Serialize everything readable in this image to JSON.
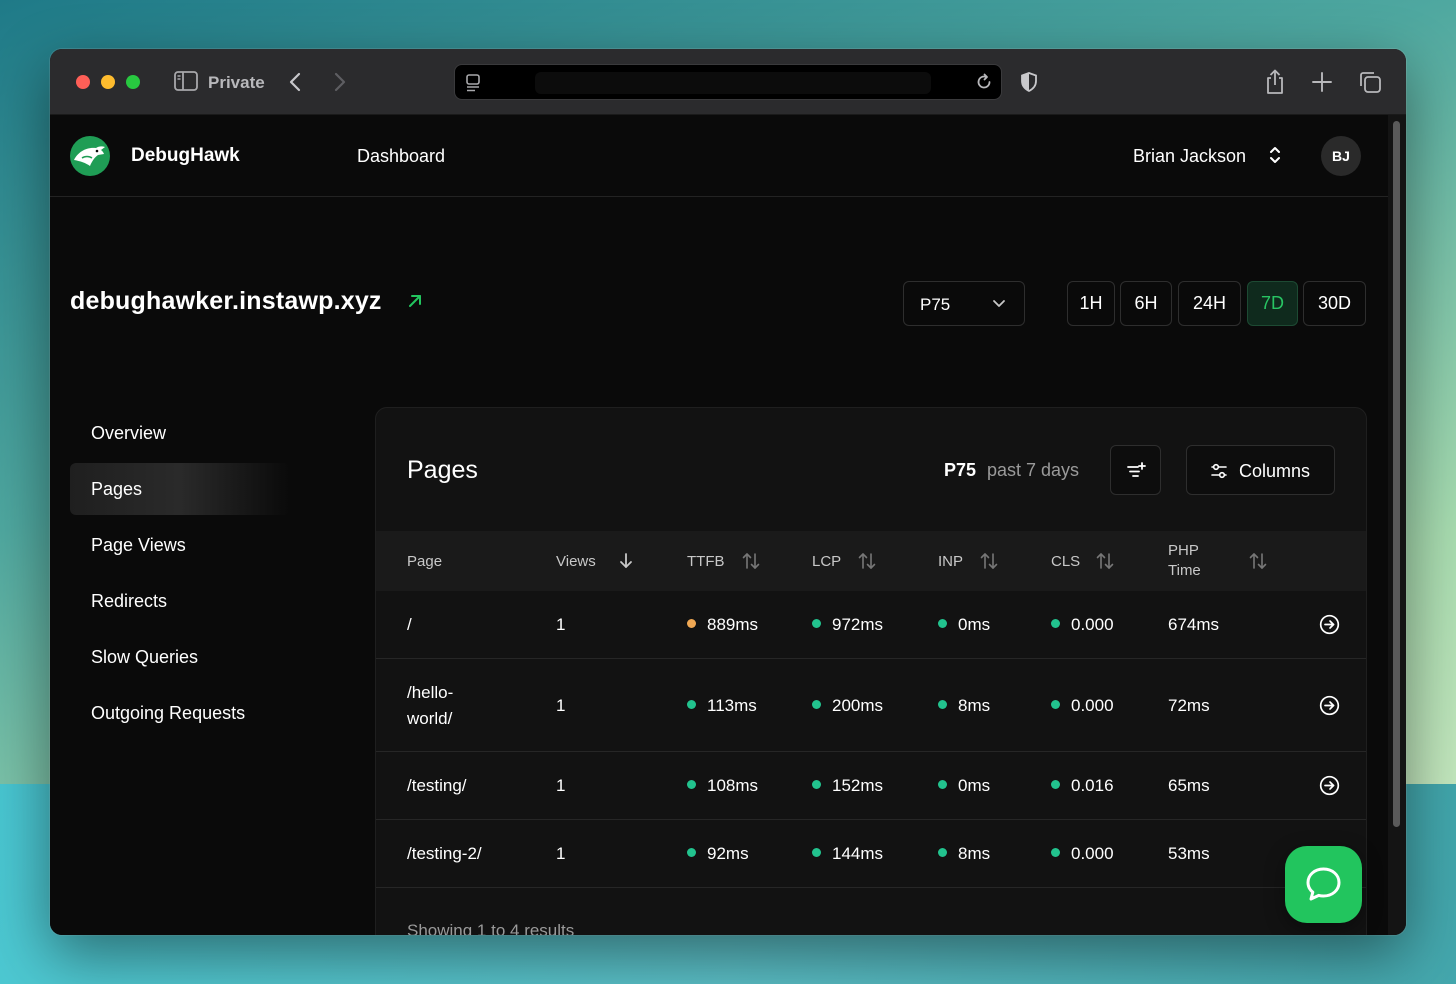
{
  "browser": {
    "private_label": "Private"
  },
  "topnav": {
    "brand": "DebugHawk",
    "dashboard_link": "Dashboard",
    "user_name": "Brian Jackson",
    "avatar_initials": "BJ"
  },
  "site": {
    "title": "debughawker.instawp.xyz"
  },
  "controls": {
    "percentile_selected": "P75",
    "ranges": [
      "1H",
      "6H",
      "24H",
      "7D",
      "30D"
    ],
    "active_range": "7D"
  },
  "sidebar": {
    "items": [
      {
        "label": "Overview"
      },
      {
        "label": "Pages",
        "active": true
      },
      {
        "label": "Page Views"
      },
      {
        "label": "Redirects"
      },
      {
        "label": "Slow Queries"
      },
      {
        "label": "Outgoing Requests"
      }
    ]
  },
  "panel": {
    "title": "Pages",
    "percentile": "P75",
    "range_text": "past 7 days",
    "columns_button": "Columns",
    "headers": {
      "page": "Page",
      "views": "Views",
      "ttfb": "TTFB",
      "lcp": "LCP",
      "inp": "INP",
      "cls": "CLS",
      "php_line1": "PHP",
      "php_line2": "Time"
    },
    "rows": [
      {
        "page": "/",
        "views": "1",
        "ttfb": "889ms",
        "ttfb_status": "orange",
        "lcp": "972ms",
        "inp": "0ms",
        "cls": "0.000",
        "php": "674ms"
      },
      {
        "page_line1": "/hello-",
        "page_line2": "world/",
        "views": "1",
        "ttfb": "113ms",
        "ttfb_status": "green",
        "lcp": "200ms",
        "inp": "8ms",
        "cls": "0.000",
        "php": "72ms"
      },
      {
        "page": "/testing/",
        "views": "1",
        "ttfb": "108ms",
        "ttfb_status": "green",
        "lcp": "152ms",
        "inp": "0ms",
        "cls": "0.016",
        "php": "65ms"
      },
      {
        "page": "/testing-2/",
        "views": "1",
        "ttfb": "92ms",
        "ttfb_status": "green",
        "lcp": "144ms",
        "inp": "8ms",
        "cls": "0.000",
        "php": "53ms"
      }
    ],
    "footer": "Showing 1 to 4 results"
  },
  "colors": {
    "accent_green": "#22c55e",
    "status_good": "#22c38e",
    "status_warn": "#f0a854"
  }
}
